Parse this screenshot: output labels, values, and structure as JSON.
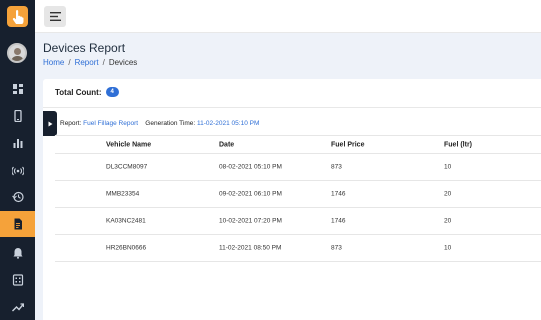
{
  "app": {
    "logo_icon": "hand-pointer-icon",
    "accent": "#f5a23a",
    "sidebar_bg": "#17202e",
    "link_color": "#2f6fd6"
  },
  "sidebar": {
    "items": [
      {
        "icon": "dashboard-icon"
      },
      {
        "icon": "mobile-device-icon"
      },
      {
        "icon": "bar-chart-icon"
      },
      {
        "icon": "signal-broadcast-icon"
      },
      {
        "icon": "history-icon"
      },
      {
        "icon": "report-document-icon",
        "active": true
      },
      {
        "icon": "bell-icon"
      },
      {
        "icon": "calculator-icon"
      },
      {
        "icon": "trend-line-icon"
      }
    ]
  },
  "header": {
    "title": "Devices Report",
    "breadcrumb": {
      "home": "Home",
      "sep1": "/",
      "report": "Report",
      "sep2": "/",
      "current": "Devices"
    }
  },
  "summary": {
    "total_label": "Total Count:",
    "total_value": "4"
  },
  "report_info": {
    "report_label": "Report:",
    "report_value": "Fuel Fillage Report",
    "gen_label": "Generation Time:",
    "gen_value": "11-02-2021 05:10 PM"
  },
  "table": {
    "columns": [
      "Vehicle Name",
      "Date",
      "Fuel Price",
      "Fuel (ltr)"
    ],
    "rows": [
      [
        "DL3CCM8097",
        "08-02-2021 05:10 PM",
        "873",
        "10"
      ],
      [
        "MMB23354",
        "09-02-2021 06:10 PM",
        "1746",
        "20"
      ],
      [
        "KA03NC2481",
        "10-02-2021 07:20 PM",
        "1746",
        "20"
      ],
      [
        "HR26BN0666",
        "11-02-2021 08:50 PM",
        "873",
        "10"
      ]
    ]
  }
}
